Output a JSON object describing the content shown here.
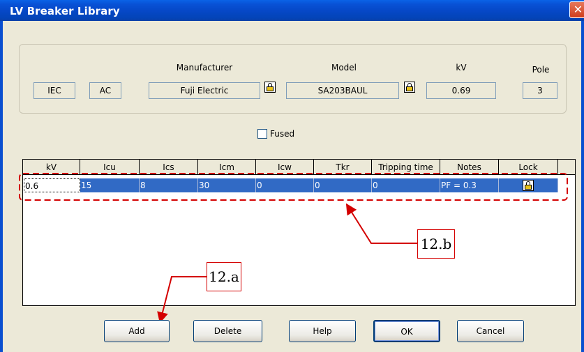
{
  "window": {
    "title": "LV Breaker Library",
    "close_glyph": "✕"
  },
  "header": {
    "standard": "IEC",
    "type": "AC",
    "manufacturer_label": "Manufacturer",
    "manufacturer": "Fuji Electric",
    "model_label": "Model",
    "model": "SA203BAUL",
    "kv_label": "kV",
    "kv": "0.69",
    "pole_label": "Pole",
    "pole": "3"
  },
  "fused": {
    "label": "Fused",
    "checked": false
  },
  "table": {
    "columns": [
      "kV",
      "Icu",
      "Ics",
      "Icm",
      "Icw",
      "Tkr",
      "Tripping time",
      "Notes",
      "Lock"
    ],
    "rows": [
      {
        "kv": "0.6",
        "icu": "15",
        "ics": "8",
        "icm": "30",
        "icw": "0",
        "tkr": "0",
        "tripping_time": "0",
        "notes": "PF = 0.3",
        "lock": "lock-icon"
      }
    ]
  },
  "annotations": {
    "a": "12.a",
    "b": "12.b"
  },
  "buttons": {
    "add": "Add",
    "delete": "Delete",
    "help": "Help",
    "ok": "OK",
    "cancel": "Cancel"
  },
  "colors": {
    "title_bar": "#0a4fd0",
    "selection": "#316ac5",
    "annotation": "#d40000",
    "dialog_bg": "#ece9d8"
  }
}
